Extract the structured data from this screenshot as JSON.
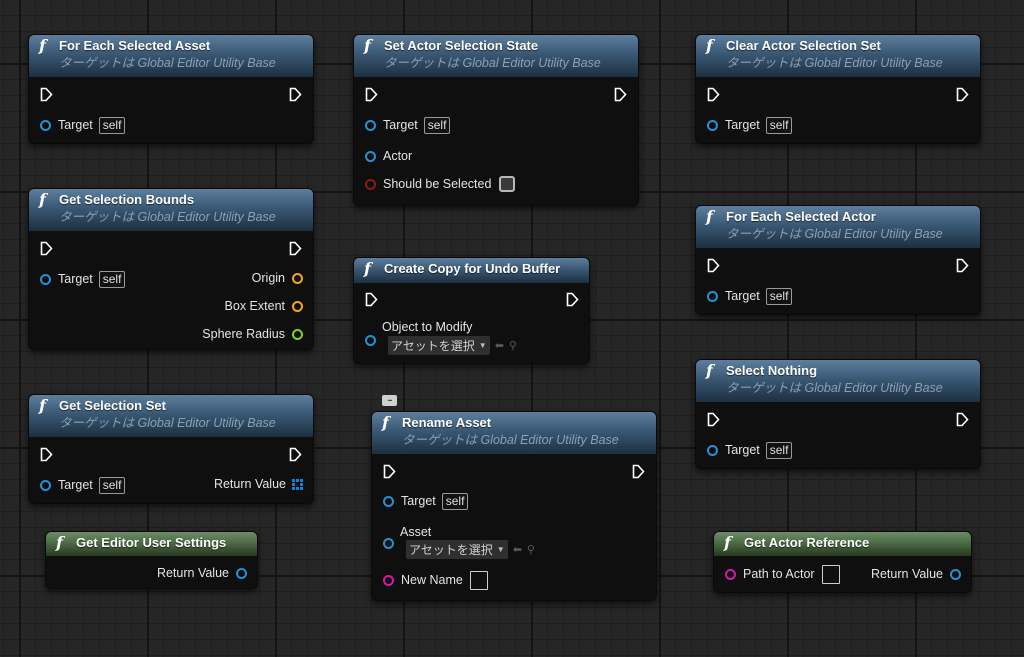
{
  "nodes": {
    "for_each_selected_asset": {
      "title": "For Each Selected Asset",
      "subtitle": "ターゲットは Global Editor Utility Base",
      "target_label": "Target",
      "self_label": "self"
    },
    "get_selection_bounds": {
      "title": "Get Selection Bounds",
      "subtitle": "ターゲットは Global Editor Utility Base",
      "target_label": "Target",
      "self_label": "self",
      "origin_label": "Origin",
      "box_extent_label": "Box Extent",
      "sphere_radius_label": "Sphere Radius"
    },
    "get_selection_set": {
      "title": "Get Selection Set",
      "subtitle": "ターゲットは Global Editor Utility Base",
      "target_label": "Target",
      "self_label": "self",
      "return_label": "Return Value"
    },
    "get_editor_user_settings": {
      "title": "Get Editor User Settings",
      "return_label": "Return Value"
    },
    "set_actor_selection_state": {
      "title": "Set Actor Selection State",
      "subtitle": "ターゲットは Global Editor Utility Base",
      "target_label": "Target",
      "self_label": "self",
      "actor_label": "Actor",
      "should_be_selected_label": "Should be Selected"
    },
    "create_copy_for_undo_buffer": {
      "title": "Create Copy for Undo Buffer",
      "object_label": "Object to Modify",
      "asset_picker": "アセットを選択"
    },
    "rename_asset": {
      "title": "Rename Asset",
      "subtitle": "ターゲットは Global Editor Utility Base",
      "target_label": "Target",
      "self_label": "self",
      "asset_label": "Asset",
      "asset_picker": "アセットを選択",
      "new_name_label": "New Name"
    },
    "clear_actor_selection_set": {
      "title": "Clear Actor Selection Set",
      "subtitle": "ターゲットは Global Editor Utility Base",
      "target_label": "Target",
      "self_label": "self"
    },
    "for_each_selected_actor": {
      "title": "For Each Selected Actor",
      "subtitle": "ターゲットは Global Editor Utility Base",
      "target_label": "Target",
      "self_label": "self"
    },
    "select_nothing": {
      "title": "Select Nothing",
      "subtitle": "ターゲットは Global Editor Utility Base",
      "target_label": "Target",
      "self_label": "self"
    },
    "get_actor_reference": {
      "title": "Get Actor Reference",
      "path_label": "Path to Actor",
      "return_label": "Return Value"
    }
  },
  "icons": {
    "function": "function-icon",
    "exec": "exec-pin-icon",
    "comment": "comment-bubble-icon",
    "array": "array-grid-icon"
  },
  "colors": {
    "object_pin": "#2a8fd2",
    "bool_pin": "#8c1a1a",
    "string_pin": "#d21aa8",
    "vector_pin": "#f2a71a",
    "float_pin": "#86d11f",
    "impure_header": "#3a5874",
    "pure_header": "#4c6b46"
  }
}
